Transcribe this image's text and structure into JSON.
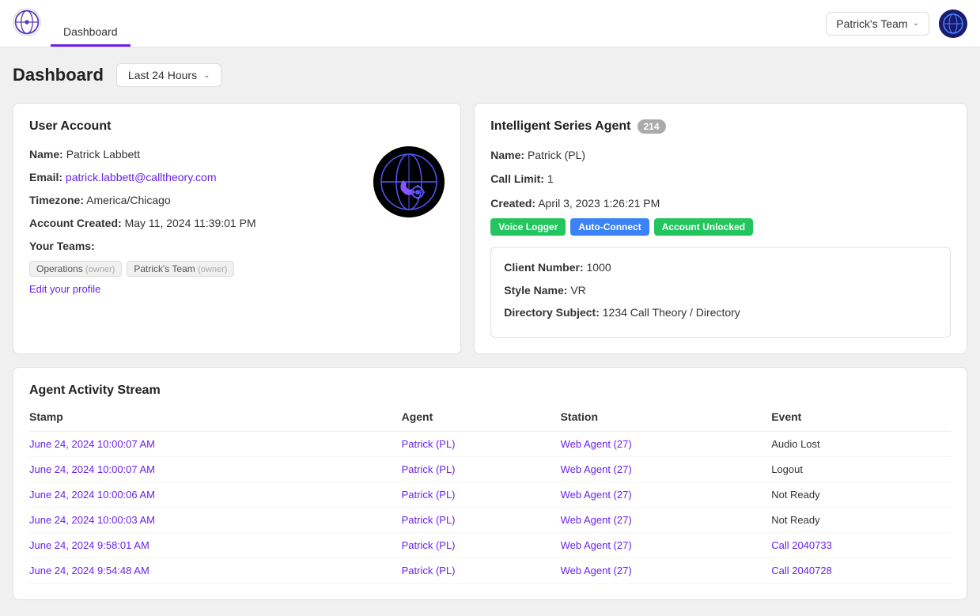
{
  "header": {
    "tab_label": "Dashboard",
    "team_name": "Patrick's Team",
    "team_chevron": "⌄"
  },
  "page": {
    "title": "Dashboard",
    "time_filter": "Last 24 Hours"
  },
  "user_account": {
    "section_title": "User Account",
    "name_label": "Name:",
    "name_value": "Patrick Labbett",
    "email_label": "Email:",
    "email_value": "patrick.labbett@calltheory.com",
    "timezone_label": "Timezone:",
    "timezone_value": "America/Chicago",
    "account_created_label": "Account Created:",
    "account_created_value": "May 11, 2024 11:39:01 PM",
    "teams_label": "Your Teams:",
    "teams": [
      {
        "name": "Operations",
        "role": "owner"
      },
      {
        "name": "Patrick's Team",
        "role": "owner"
      }
    ],
    "edit_link": "Edit your profile"
  },
  "agent": {
    "section_title": "Intelligent Series Agent",
    "badge_count": "214",
    "name_label": "Name:",
    "name_value": "Patrick (PL)",
    "call_limit_label": "Call Limit:",
    "call_limit_value": "1",
    "created_label": "Created:",
    "created_value": "April 3, 2023 1:26:21 PM",
    "status_badges": [
      "Voice Logger",
      "Auto-Connect",
      "Account Unlocked"
    ],
    "client_number_label": "Client Number:",
    "client_number_value": "1000",
    "style_name_label": "Style Name:",
    "style_name_value": "VR",
    "directory_subject_label": "Directory Subject:",
    "directory_subject_value": "1234 Call Theory / Directory"
  },
  "activity_stream": {
    "section_title": "Agent Activity Stream",
    "columns": [
      "Stamp",
      "Agent",
      "Station",
      "Event"
    ],
    "rows": [
      {
        "stamp": "June 24, 2024 10:00:07 AM",
        "agent": "Patrick (PL)",
        "station": "Web Agent (27)",
        "event": "Audio Lost",
        "event_is_link": false
      },
      {
        "stamp": "June 24, 2024 10:00:07 AM",
        "agent": "Patrick (PL)",
        "station": "Web Agent (27)",
        "event": "Logout",
        "event_is_link": false
      },
      {
        "stamp": "June 24, 2024 10:00:06 AM",
        "agent": "Patrick (PL)",
        "station": "Web Agent (27)",
        "event": "Not Ready",
        "event_is_link": false
      },
      {
        "stamp": "June 24, 2024 10:00:03 AM",
        "agent": "Patrick (PL)",
        "station": "Web Agent (27)",
        "event": "Not Ready",
        "event_is_link": false
      },
      {
        "stamp": "June 24, 2024 9:58:01 AM",
        "agent": "Patrick (PL)",
        "station": "Web Agent (27)",
        "event": "Call 2040733",
        "event_is_link": true
      },
      {
        "stamp": "June 24, 2024 9:54:48 AM",
        "agent": "Patrick (PL)",
        "station": "Web Agent (27)",
        "event": "Call 2040728",
        "event_is_link": true
      }
    ]
  }
}
